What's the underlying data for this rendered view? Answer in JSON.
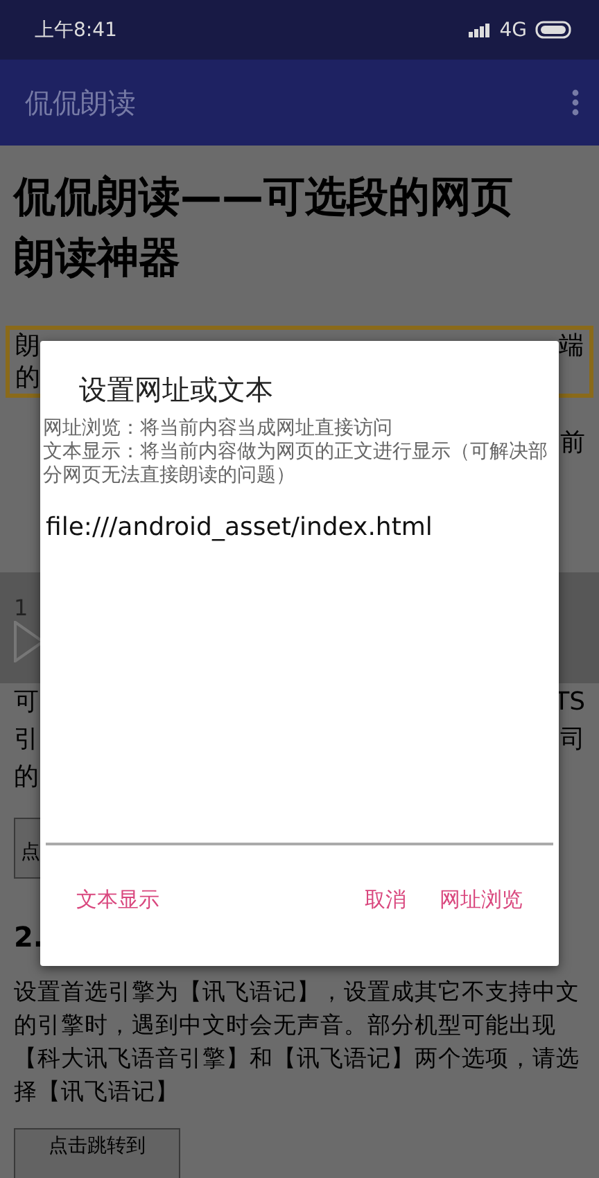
{
  "status_bar": {
    "time": "上午8:41",
    "network": "4G"
  },
  "app_bar": {
    "title": "侃侃朗读"
  },
  "page": {
    "heading": "侃侃朗读——可选段的网页朗读神器",
    "highlight_box": {
      "left": [
        "朗",
        "的"
      ],
      "right": [
        "端"
      ]
    },
    "fragments_right": [
      "前"
    ],
    "player": {
      "number": "1"
    },
    "fragment_rows": [
      {
        "left": "可",
        "right": "TS"
      },
      {
        "left": "引",
        "right": "司"
      },
      {
        "left": "的",
        "right": ""
      }
    ],
    "partial_button": "点",
    "section_number": "2.",
    "paragraph": "设置首选引擎为【讯飞语记】，设置成其它不支持中文的引擎时，遇到中文时会无声音。部分机型可能出现【科大讯飞语音引擎】和【讯飞语记】两个选项，请选择【讯飞语记】",
    "bottom_button": "点击跳转到"
  },
  "dialog": {
    "title": "设置网址或文本",
    "description": [
      "网址浏览：将当前内容当成网址直接访问",
      "文本显示：将当前内容做为网页的正文进行显示（可解决部分网页无法直接朗读的问题）"
    ],
    "input": {
      "value": "file:///android_asset/index.html"
    },
    "buttons": [
      {
        "label": "文本显示",
        "kind": "left"
      },
      {
        "label": "取消",
        "kind": "right"
      },
      {
        "label": "网址浏览",
        "kind": "right"
      }
    ]
  }
}
